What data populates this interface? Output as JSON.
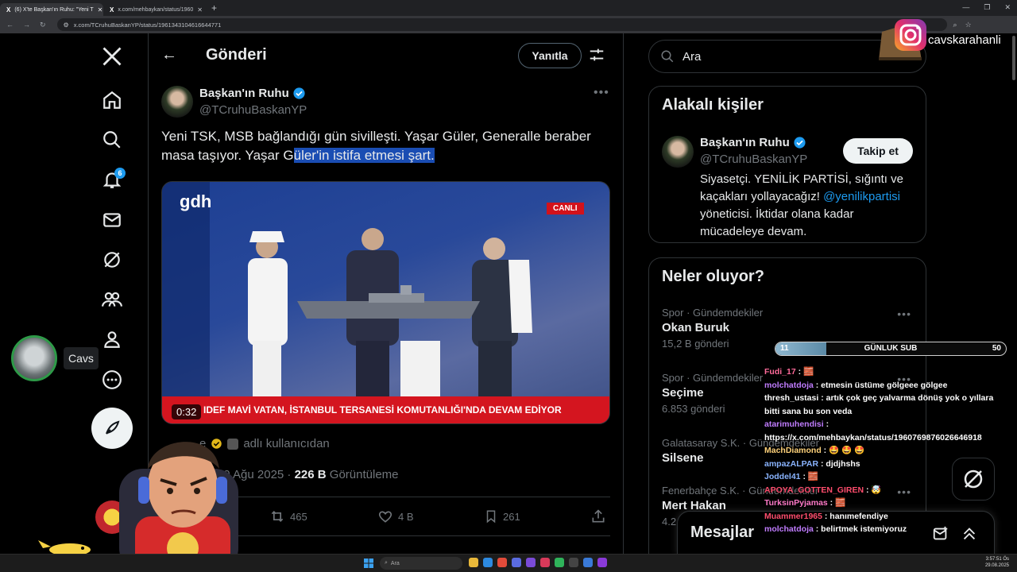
{
  "browser": {
    "tabs": [
      {
        "label": "(6) X'te Başkan'ın Ruhu: \"Yeni T",
        "active": true
      },
      {
        "label": "x.com/mehbaykan/status/1960",
        "active": false
      }
    ],
    "url": "x.com/TCruhuBaskanYP/status/1961343104616644771"
  },
  "nav": {
    "items": [
      "home-icon",
      "search-icon",
      "bell-icon",
      "mail-icon",
      "grok-icon",
      "communities-icon",
      "profile-icon",
      "more-icon"
    ],
    "notifications_badge": "6"
  },
  "overlay": {
    "cavs_label": "Cavs",
    "instagram_name": "cavskarahanli"
  },
  "post_header": {
    "title": "Gönderi",
    "reply_button": "Yanıtla"
  },
  "tweet": {
    "author_name": "Başkan'ın Ruhu",
    "author_handle": "@TCruhuBaskanYP",
    "text_plain": "Yeni TSK, MSB bağlandığı gün sivilleşti. Yaşar Güler, Generalle beraber masa taşıyor. Yaşar G",
    "text_highlighted": "üler'in istifa etmesi şart.",
    "media": {
      "logo": "gdh",
      "live_badge": "CANLI",
      "ticker": "IDEF MAVİ VATAN, İSTANBUL TERSANESİ KOMUTANLIĞI'NDA DEVAM EDİYOR",
      "timestamp": "0:32"
    },
    "attribution": "adlı kullanıcıdan",
    "attribution_prefix": "e",
    "date": "29 Ağu 2025 · ",
    "views_count": "226 B",
    "views_label": " Görüntüleme",
    "retweets": "465",
    "likes": "4 B",
    "bookmarks": "261"
  },
  "sidebar": {
    "search_placeholder": "Ara",
    "related": {
      "title": "Alakalı kişiler",
      "name": "Başkan'ın Ruhu",
      "handle": "@TCruhuBaskanYP",
      "follow": "Takip et",
      "bio_before": "Siyasetçi. YENİLİK PARTİSİ, sığıntı ve kaçakları yollayacağız! ",
      "bio_link": "@yenilikpartisi",
      "bio_after": " yöneticisi. İktidar olana kadar mücadeleye devam."
    },
    "trends_title": "Neler oluyor?",
    "trends": [
      {
        "category": "Spor · Gündemdekiler",
        "name": "Okan Buruk",
        "count": "15,2 B gönderi"
      },
      {
        "category": "Spor · Gündemdekiler",
        "name": "Seçime",
        "count": "6.853 gönderi"
      },
      {
        "category": "Galatasaray S.K. · Gündemdekiler",
        "name": "Silsene",
        "count": ""
      },
      {
        "category": "Fenerbahçe S.K. · Gündemdekiler",
        "name": "Mert Hakan",
        "count": "4.2"
      }
    ],
    "messages_title": "Mesajlar"
  },
  "sub_goal": {
    "current": "11",
    "label": "GÜNLUK SUB",
    "target": "50",
    "progress_fraction": 0.22
  },
  "chat": [
    {
      "user": "Fudi_17",
      "color": "#ff6b9a",
      "text": " : 🧱"
    },
    {
      "user": "molchatdoja",
      "color": "#c07cff",
      "text": " : etmesin üstüme gölgeee gölgee"
    },
    {
      "user": "thresh_ustasi",
      "color": "#ffffff",
      "text": " : artık çok geç yalvarma dönüş yok o yıllara bitti sana bu son veda"
    },
    {
      "user": "atarimuhendisi",
      "color": "#c07cff",
      "text": " : https://x.com/mehbaykan/status/1960769876026646918"
    },
    {
      "user": "MachDiamond",
      "color": "#ffd27a",
      "text": " : 🤩 🤩 🤩"
    },
    {
      "user": "ampazALPAR",
      "color": "#8ab4ff",
      "text": " : djdjhshs"
    },
    {
      "user": "Joddel41",
      "color": "#8ab4ff",
      "text": " : 🧱"
    },
    {
      "user": "APOYA_GOTTEN_GIREN",
      "color": "#ff4d6d",
      "text": " : 🤯"
    },
    {
      "user": "TurksinPyjamas",
      "color": "#ff7ac8",
      "text": " : 🧱"
    },
    {
      "user": "Muammer1965",
      "color": "#ff4d6d",
      "text": " : hanımefendiye"
    },
    {
      "user": "molchatdoja",
      "color": "#c07cff",
      "text": " : belirtmek istemiyoruz"
    }
  ],
  "taskbar": {
    "search": "Ara",
    "time": "3:57:51 Ös",
    "date": "29.08.2025"
  }
}
